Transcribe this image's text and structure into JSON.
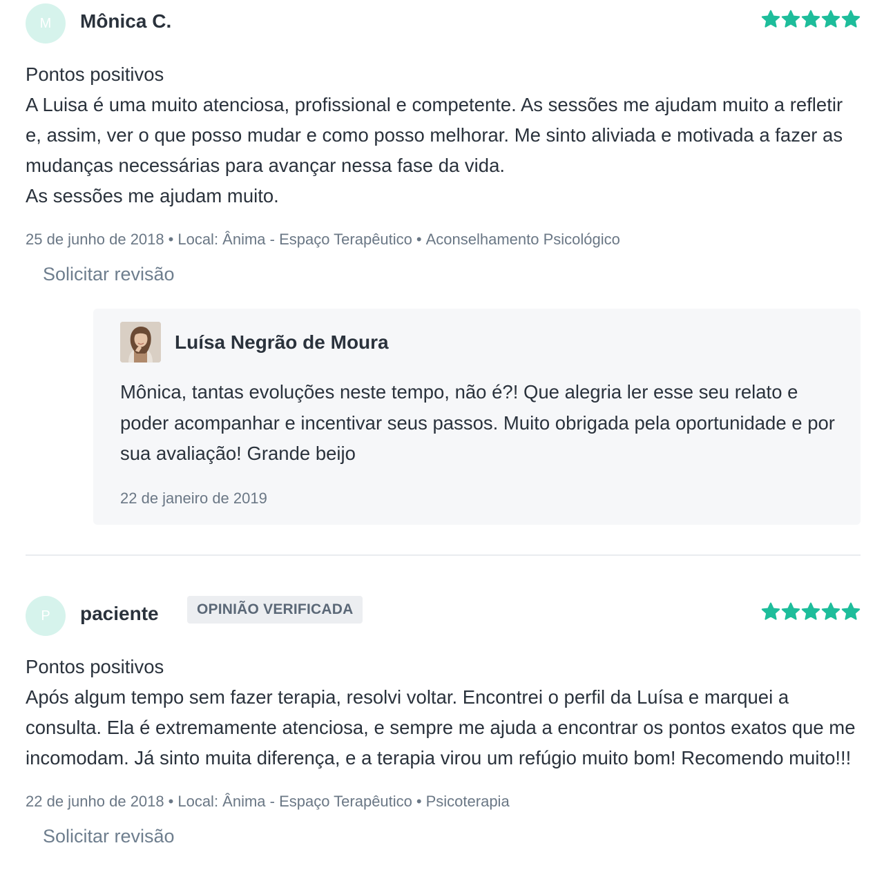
{
  "colors": {
    "star": "#1ebd9b",
    "avatar_bg": "#d6f3ec",
    "reply_bg": "#f6f7f9",
    "badge_bg": "#eceef1",
    "meta_text": "#6a7785"
  },
  "reviews": [
    {
      "initial": "M",
      "author": "Mônica C.",
      "rating": 5,
      "heading": "Pontos positivos",
      "text": "A Luisa é uma muito atenciosa, profissional e competente. As sessões me ajudam muito a refletir e, assim, ver o que posso mudar e como posso melhorar. Me sinto aliviada e motivada a fazer as mudanças necessárias para avançar nessa fase da vida.",
      "text2": "As sessões me ajudam muito.",
      "date": "25 de junho de 2018",
      "location": "Local: Ânima - Espaço Terapêutico",
      "service": "Aconselhamento Psicológico",
      "action_label": "Solicitar revisão",
      "reply": {
        "author": "Luísa Negrão de Moura",
        "avatar_icon": "profile-photo",
        "text": "Mônica, tantas evoluções neste tempo, não é?! Que alegria ler esse seu relato e poder acompanhar e incentivar seus passos. Muito obrigada pela oportunidade e por sua avaliação! Grande beijo",
        "date": "22 de janeiro de 2019"
      }
    },
    {
      "initial": "P",
      "author": "paciente",
      "badge": "OPINIÃO VERIFICADA",
      "rating": 5,
      "heading": "Pontos positivos",
      "text": "Após algum tempo sem fazer terapia, resolvi voltar. Encontrei o perfil da Luísa e marquei a consulta. Ela é extremamente atenciosa, e sempre me ajuda a encontrar os pontos exatos que me incomodam. Já sinto muita diferença, e a terapia virou um refúgio muito bom! Recomendo muito!!!",
      "date": "22 de junho de 2018",
      "location": "Local: Ânima - Espaço Terapêutico",
      "service": "Psicoterapia",
      "action_label": "Solicitar revisão"
    }
  ]
}
